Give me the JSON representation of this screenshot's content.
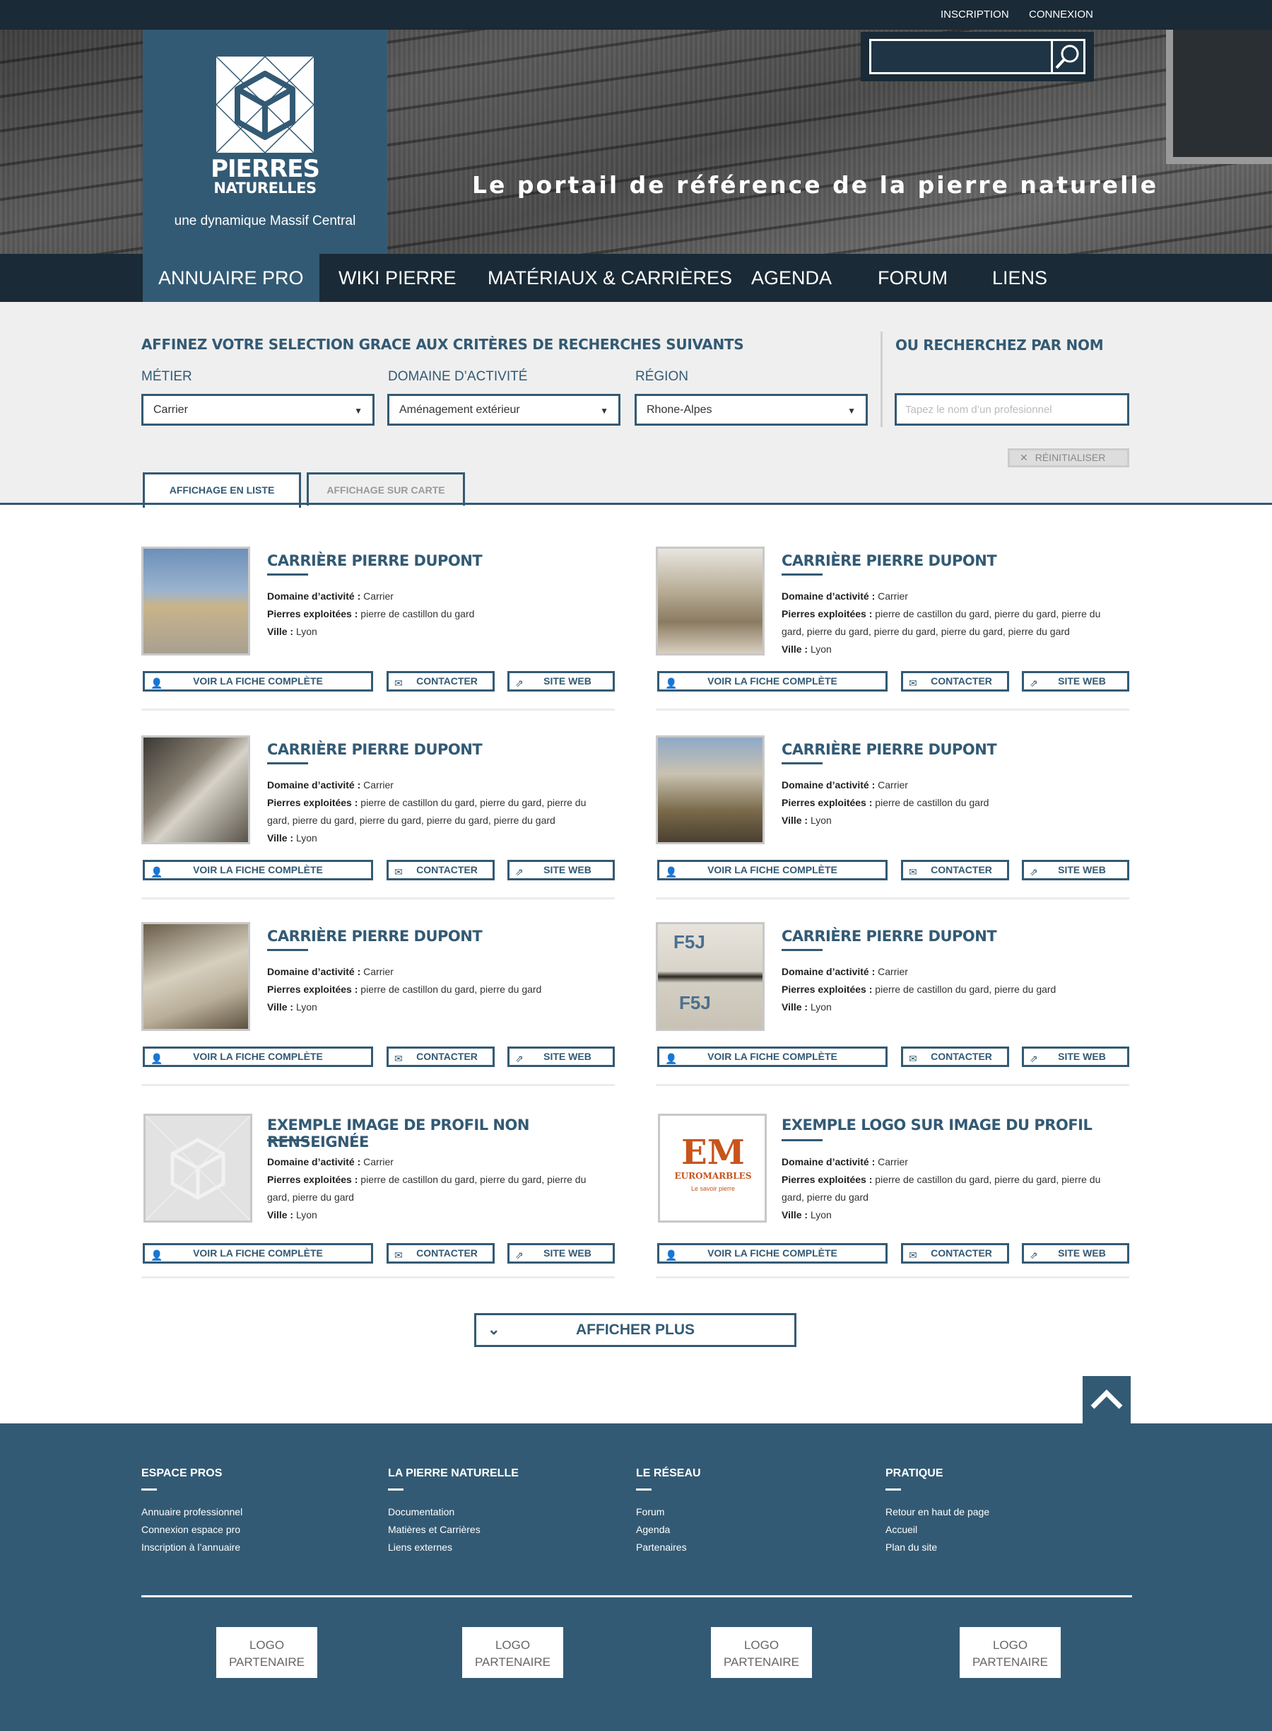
{
  "topbar": {
    "inscription": "INSCRIPTION",
    "connexion": "CONNEXION"
  },
  "logo": {
    "line1": "PIERRES",
    "line2": "NATURELLES",
    "sub": "une dynamique Massif Central"
  },
  "hero": {
    "tagline": "Le portail de référence de la pierre naturelle"
  },
  "nav": [
    "ANNUAIRE PRO",
    "WIKI PIERRE",
    "MATÉRIAUX & CARRIÈRES",
    "AGENDA",
    "FORUM",
    "LIENS"
  ],
  "filters": {
    "title": "AFFINEZ VOTRE SELECTION GRACE AUX CRITÈRES DE RECHERCHES SUIVANTS",
    "metier_label": "MÉTIER",
    "metier_value": "Carrier",
    "domaine_label": "DOMAINE D’ACTIVITÉ",
    "domaine_value": "Aménagement extérieur",
    "region_label": "RÉGION",
    "region_value": "Rhone-Alpes",
    "name_title": "OU RECHERCHEZ PAR NOM",
    "name_placeholder": "Tapez le nom d’un profesionnel",
    "reset": "RÉINITIALISER"
  },
  "tabs": {
    "list": "AFFICHAGE EN LISTE",
    "map": "AFFICHAGE SUR CARTE"
  },
  "labels": {
    "domaine": "Domaine d’activité :",
    "pierres": "Pierres exploitées :",
    "ville": "Ville :",
    "btn_fiche": "VOIR LA FICHE COMPLÈTE",
    "btn_contact": "CONTACTER",
    "btn_web": "SITE WEB"
  },
  "cards": [
    {
      "title": "CARRIÈRE PIERRE DUPONT",
      "domaine": "Carrier",
      "pierres": "pierre de castillon du gard",
      "ville": "Lyon"
    },
    {
      "title": "CARRIÈRE PIERRE DUPONT",
      "domaine": "Carrier",
      "pierres": "pierre de castillon du gard, pierre du gard, pierre du gard, pierre du gard, pierre du gard, pierre du gard, pierre du gard",
      "ville": "Lyon"
    },
    {
      "title": "CARRIÈRE PIERRE DUPONT",
      "domaine": "Carrier",
      "pierres": "pierre de castillon du gard, pierre du gard, pierre du gard, pierre du gard, pierre du gard, pierre du gard, pierre du gard",
      "ville": "Lyon"
    },
    {
      "title": "CARRIÈRE PIERRE DUPONT",
      "domaine": "Carrier",
      "pierres": "pierre de castillon du gard",
      "ville": "Lyon"
    },
    {
      "title": "CARRIÈRE PIERRE DUPONT",
      "domaine": "Carrier",
      "pierres": "pierre de castillon du gard, pierre du gard",
      "ville": "Lyon"
    },
    {
      "title": "CARRIÈRE PIERRE DUPONT",
      "domaine": "Carrier",
      "pierres": "pierre de castillon du gard, pierre du gard",
      "ville": "Lyon"
    },
    {
      "title": "EXEMPLE IMAGE DE PROFIL NON RENSEIGNÉE",
      "domaine": "Carrier",
      "pierres": "pierre de castillon du gard, pierre du gard, pierre du gard, pierre du gard",
      "ville": "Lyon"
    },
    {
      "title": "EXEMPLE LOGO SUR IMAGE DU PROFIL",
      "domaine": "Carrier",
      "pierres": "pierre de castillon du gard, pierre du gard, pierre du gard, pierre du gard",
      "ville": "Lyon"
    }
  ],
  "images": {
    "f5j_1": "F5J",
    "f5j_2": "F5J",
    "em_big": "EM",
    "em_name": "EUROMARBLES",
    "em_tag": "Le savoir pierre"
  },
  "more": "AFFICHER PLUS",
  "footer": {
    "cols": [
      {
        "title": "ESPACE PROS",
        "links": [
          "Annuaire professionnel",
          "Connexion espace pro",
          "Inscription à l’annuaire"
        ]
      },
      {
        "title": "LA PIERRE NATURELLE",
        "links": [
          "Documentation",
          "Matières et Carrières",
          "Liens externes"
        ]
      },
      {
        "title": "LE RÉSEAU",
        "links": [
          "Forum",
          "Agenda",
          "Partenaires"
        ]
      },
      {
        "title": "PRATIQUE",
        "links": [
          "Retour en haut de page",
          "Accueil",
          "Plan du site"
        ]
      }
    ],
    "partner_line1": "LOGO",
    "partner_line2": "PARTENAIRE"
  },
  "colors": {
    "primary": "#335a74",
    "dark": "#1a2a36",
    "light_bg": "#efefef"
  }
}
